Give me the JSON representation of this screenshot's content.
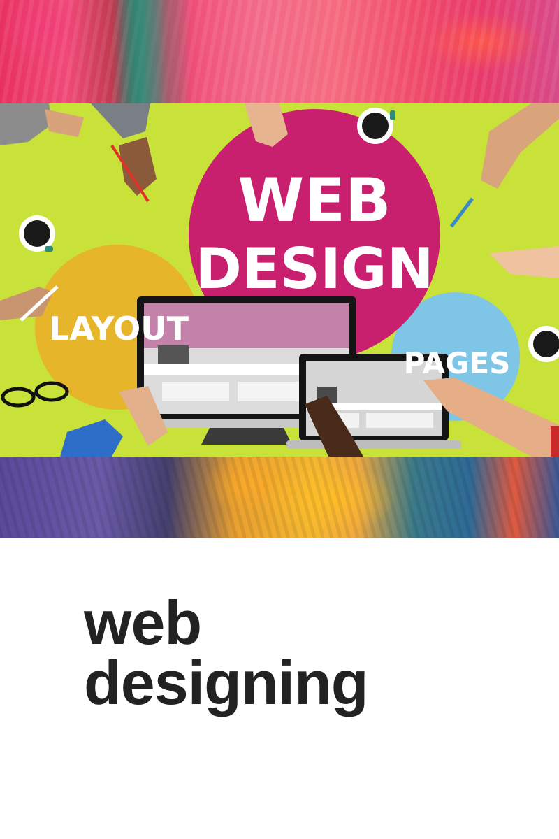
{
  "banner": {
    "circle_main_line1": "WEB",
    "circle_main_line2": "DESIGN",
    "circle_left": "LAYOUT",
    "circle_right": "PAGES"
  },
  "heading": {
    "line1": "web",
    "line2": "designing"
  },
  "colors": {
    "banner_background": "#c8e23a",
    "magenta_circle": "#c8206e",
    "yellow_circle": "#e8b228",
    "blue_circle": "#7fc6e6",
    "heading_text": "#222222"
  }
}
